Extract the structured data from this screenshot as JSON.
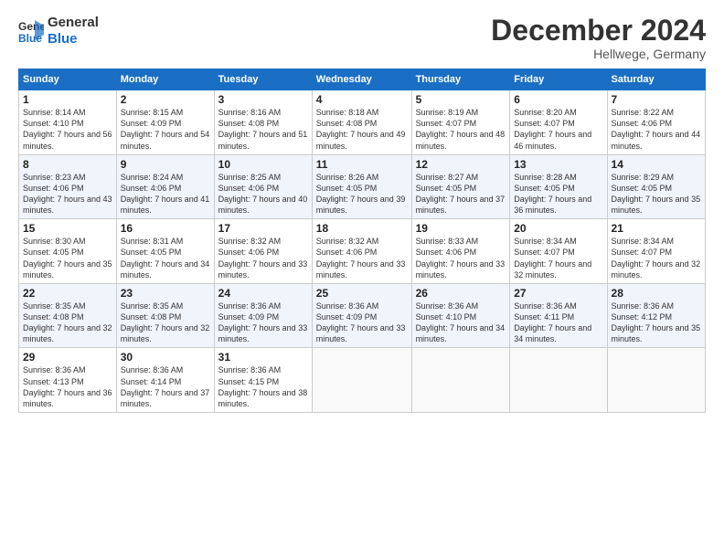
{
  "header": {
    "logo_line1": "General",
    "logo_line2": "Blue",
    "month": "December 2024",
    "location": "Hellwege, Germany"
  },
  "days_of_week": [
    "Sunday",
    "Monday",
    "Tuesday",
    "Wednesday",
    "Thursday",
    "Friday",
    "Saturday"
  ],
  "weeks": [
    [
      {
        "num": "1",
        "sunrise": "8:14 AM",
        "sunset": "4:10 PM",
        "daylight": "7 hours and 56 minutes."
      },
      {
        "num": "2",
        "sunrise": "8:15 AM",
        "sunset": "4:09 PM",
        "daylight": "7 hours and 54 minutes."
      },
      {
        "num": "3",
        "sunrise": "8:16 AM",
        "sunset": "4:08 PM",
        "daylight": "7 hours and 51 minutes."
      },
      {
        "num": "4",
        "sunrise": "8:18 AM",
        "sunset": "4:08 PM",
        "daylight": "7 hours and 49 minutes."
      },
      {
        "num": "5",
        "sunrise": "8:19 AM",
        "sunset": "4:07 PM",
        "daylight": "7 hours and 48 minutes."
      },
      {
        "num": "6",
        "sunrise": "8:20 AM",
        "sunset": "4:07 PM",
        "daylight": "7 hours and 46 minutes."
      },
      {
        "num": "7",
        "sunrise": "8:22 AM",
        "sunset": "4:06 PM",
        "daylight": "7 hours and 44 minutes."
      }
    ],
    [
      {
        "num": "8",
        "sunrise": "8:23 AM",
        "sunset": "4:06 PM",
        "daylight": "7 hours and 43 minutes."
      },
      {
        "num": "9",
        "sunrise": "8:24 AM",
        "sunset": "4:06 PM",
        "daylight": "7 hours and 41 minutes."
      },
      {
        "num": "10",
        "sunrise": "8:25 AM",
        "sunset": "4:06 PM",
        "daylight": "7 hours and 40 minutes."
      },
      {
        "num": "11",
        "sunrise": "8:26 AM",
        "sunset": "4:05 PM",
        "daylight": "7 hours and 39 minutes."
      },
      {
        "num": "12",
        "sunrise": "8:27 AM",
        "sunset": "4:05 PM",
        "daylight": "7 hours and 37 minutes."
      },
      {
        "num": "13",
        "sunrise": "8:28 AM",
        "sunset": "4:05 PM",
        "daylight": "7 hours and 36 minutes."
      },
      {
        "num": "14",
        "sunrise": "8:29 AM",
        "sunset": "4:05 PM",
        "daylight": "7 hours and 35 minutes."
      }
    ],
    [
      {
        "num": "15",
        "sunrise": "8:30 AM",
        "sunset": "4:05 PM",
        "daylight": "7 hours and 35 minutes."
      },
      {
        "num": "16",
        "sunrise": "8:31 AM",
        "sunset": "4:05 PM",
        "daylight": "7 hours and 34 minutes."
      },
      {
        "num": "17",
        "sunrise": "8:32 AM",
        "sunset": "4:06 PM",
        "daylight": "7 hours and 33 minutes."
      },
      {
        "num": "18",
        "sunrise": "8:32 AM",
        "sunset": "4:06 PM",
        "daylight": "7 hours and 33 minutes."
      },
      {
        "num": "19",
        "sunrise": "8:33 AM",
        "sunset": "4:06 PM",
        "daylight": "7 hours and 33 minutes."
      },
      {
        "num": "20",
        "sunrise": "8:34 AM",
        "sunset": "4:07 PM",
        "daylight": "7 hours and 32 minutes."
      },
      {
        "num": "21",
        "sunrise": "8:34 AM",
        "sunset": "4:07 PM",
        "daylight": "7 hours and 32 minutes."
      }
    ],
    [
      {
        "num": "22",
        "sunrise": "8:35 AM",
        "sunset": "4:08 PM",
        "daylight": "7 hours and 32 minutes."
      },
      {
        "num": "23",
        "sunrise": "8:35 AM",
        "sunset": "4:08 PM",
        "daylight": "7 hours and 32 minutes."
      },
      {
        "num": "24",
        "sunrise": "8:36 AM",
        "sunset": "4:09 PM",
        "daylight": "7 hours and 33 minutes."
      },
      {
        "num": "25",
        "sunrise": "8:36 AM",
        "sunset": "4:09 PM",
        "daylight": "7 hours and 33 minutes."
      },
      {
        "num": "26",
        "sunrise": "8:36 AM",
        "sunset": "4:10 PM",
        "daylight": "7 hours and 34 minutes."
      },
      {
        "num": "27",
        "sunrise": "8:36 AM",
        "sunset": "4:11 PM",
        "daylight": "7 hours and 34 minutes."
      },
      {
        "num": "28",
        "sunrise": "8:36 AM",
        "sunset": "4:12 PM",
        "daylight": "7 hours and 35 minutes."
      }
    ],
    [
      {
        "num": "29",
        "sunrise": "8:36 AM",
        "sunset": "4:13 PM",
        "daylight": "7 hours and 36 minutes."
      },
      {
        "num": "30",
        "sunrise": "8:36 AM",
        "sunset": "4:14 PM",
        "daylight": "7 hours and 37 minutes."
      },
      {
        "num": "31",
        "sunrise": "8:36 AM",
        "sunset": "4:15 PM",
        "daylight": "7 hours and 38 minutes."
      },
      null,
      null,
      null,
      null
    ]
  ],
  "labels": {
    "sunrise": "Sunrise: ",
    "sunset": "Sunset: ",
    "daylight": "Daylight: "
  }
}
